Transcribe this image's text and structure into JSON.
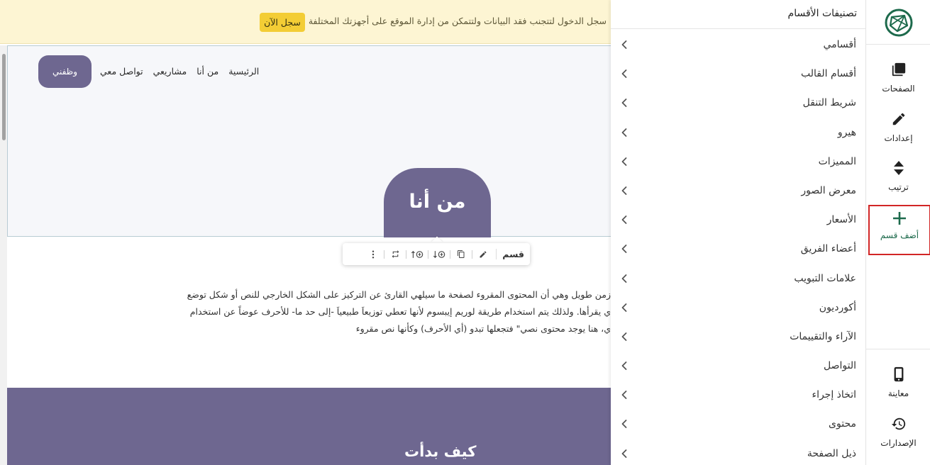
{
  "banner": {
    "message": "سجل الدخول لتتجنب فقد البيانات ولتتمكن من إدارة الموقع على أجهزتك المختلفة",
    "signup_label": "سجل الآن"
  },
  "site": {
    "nav": [
      "الرئيسية",
      "من أنا",
      "مشاريعي",
      "تواصل معي"
    ],
    "hire_label": "وظفني",
    "about_title": "من أنا",
    "paragraph_lines": [
      "زمن طويل وهي أن المحتوى المقروء لصفحة ما سيلهي القارئ عن التركيز على الشكل الخارجي للنص أو شكل توضع",
      "ي يقرأها. ولذلك يتم استخدام طريقة لوريم إيبسوم لأنها تعطي توزيعاَ طبيعياَ -إلى حد ما- للأحرف عوضاً عن استخدام",
      "ي، هنا يوجد محتوى نصي\" فتجعلها تبدو (أي الأحرف) وكأنها نص مقروء"
    ],
    "how_title": "كيف بدأت"
  },
  "toolbar": {
    "label": "قسم",
    "icons": [
      "edit-icon",
      "copy-icon",
      "add-below-icon",
      "add-above-icon",
      "swap-icon",
      "more-icon"
    ]
  },
  "panel": {
    "title": "تصنيفات الأقسام",
    "categories": [
      "أقسامي",
      "أقسام القالب",
      "شريط التنقل",
      "هيرو",
      "المميزات",
      "معرض الصور",
      "الأسعار",
      "أعضاء الفريق",
      "علامات التبويب",
      "أكورديون",
      "الآراء والتقييمات",
      "التواصل",
      "اتخاذ إجراء",
      "محتوى",
      "ذيل الصفحة"
    ]
  },
  "sidebar": {
    "pages": "الصفحات",
    "settings": "إعدادات",
    "order": "ترتيب",
    "add_section": "أضف قسم",
    "preview": "معاينة",
    "versions": "الإصدارات"
  },
  "colors": {
    "brand_purple": "#6e6790",
    "brand_green": "#1d6a4c",
    "banner_bg": "#fdf5d3",
    "signup_btn": "#f3cd35",
    "highlight_border": "#d22626"
  }
}
